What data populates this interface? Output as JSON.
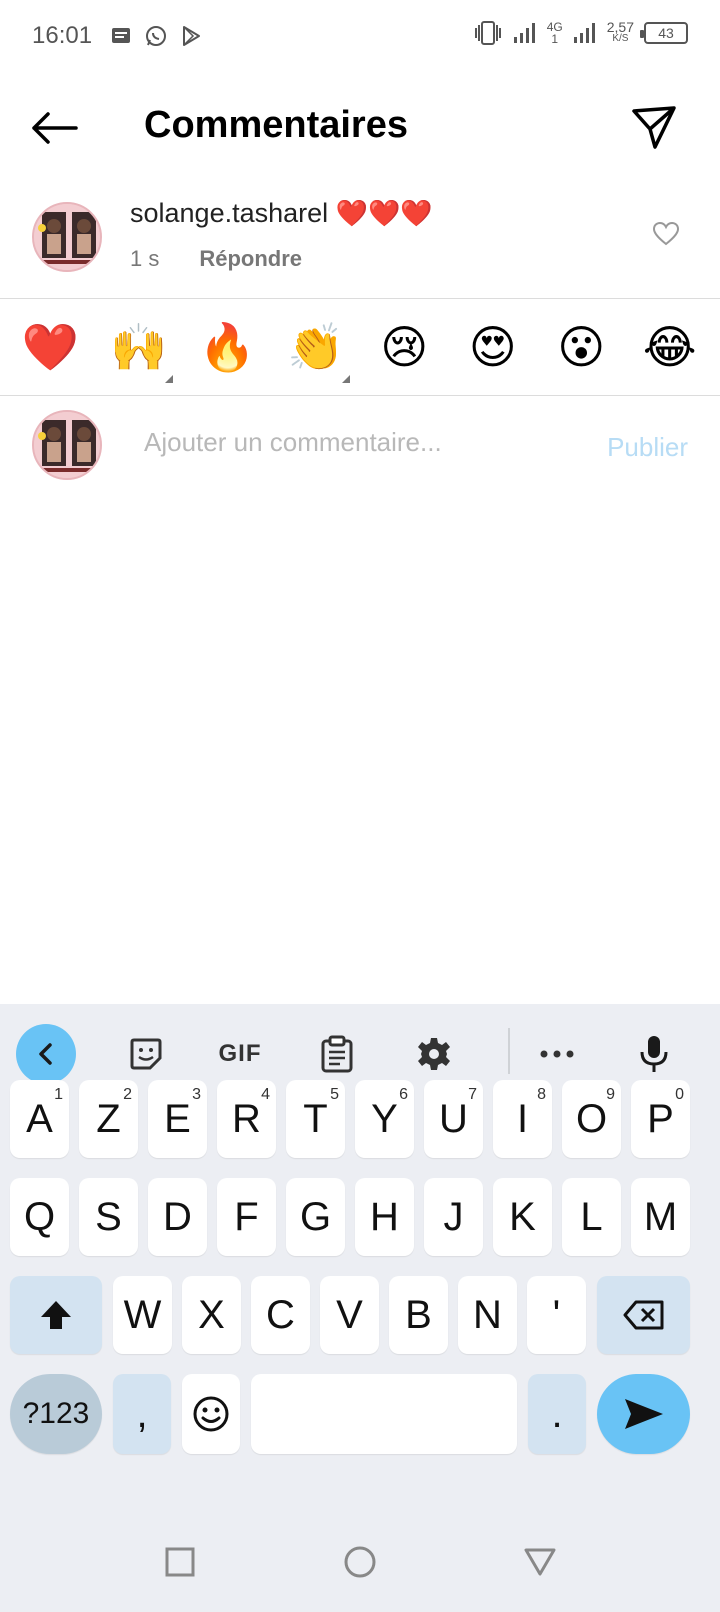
{
  "status_bar": {
    "time": "16:01",
    "network_type": "4G",
    "network_sub": "1",
    "speed_value": "2,57",
    "speed_unit": "K/S",
    "battery": "43"
  },
  "header": {
    "title": "Commentaires"
  },
  "comment": {
    "username": "solange.tasharel",
    "text": "❤️❤️❤️",
    "time_ago": "1 s",
    "reply_label": "Répondre"
  },
  "emoji_bar": [
    {
      "emoji": "❤️",
      "variants": false
    },
    {
      "emoji": "🙌",
      "variants": true
    },
    {
      "emoji": "🔥",
      "variants": false
    },
    {
      "emoji": "👏",
      "variants": true
    },
    {
      "emoji": "😢",
      "variants": false
    },
    {
      "emoji": "😍",
      "variants": false
    },
    {
      "emoji": "😮",
      "variants": false
    },
    {
      "emoji": "😂",
      "variants": false
    }
  ],
  "input": {
    "placeholder": "Ajouter un commentaire...",
    "value": "",
    "publish_label": "Publier"
  },
  "keyboard": {
    "toolbar": {
      "gif_label": "GIF"
    },
    "row1": [
      {
        "key": "A",
        "hint": "1"
      },
      {
        "key": "Z",
        "hint": "2"
      },
      {
        "key": "E",
        "hint": "3"
      },
      {
        "key": "R",
        "hint": "4"
      },
      {
        "key": "T",
        "hint": "5"
      },
      {
        "key": "Y",
        "hint": "6"
      },
      {
        "key": "U",
        "hint": "7"
      },
      {
        "key": "I",
        "hint": "8"
      },
      {
        "key": "O",
        "hint": "9"
      },
      {
        "key": "P",
        "hint": "0"
      }
    ],
    "row2": [
      "Q",
      "S",
      "D",
      "F",
      "G",
      "H",
      "J",
      "K",
      "L",
      "M"
    ],
    "row3": [
      "W",
      "X",
      "C",
      "V",
      "B",
      "N",
      "'"
    ],
    "symbols_label": "?123",
    "comma_label": ",",
    "period_label": "."
  },
  "colors": {
    "accent": "#69c3f5",
    "publish_disabled": "#b7dcf5",
    "keyboard_bg": "#eceef3",
    "special_key": "#d3e3f1"
  }
}
